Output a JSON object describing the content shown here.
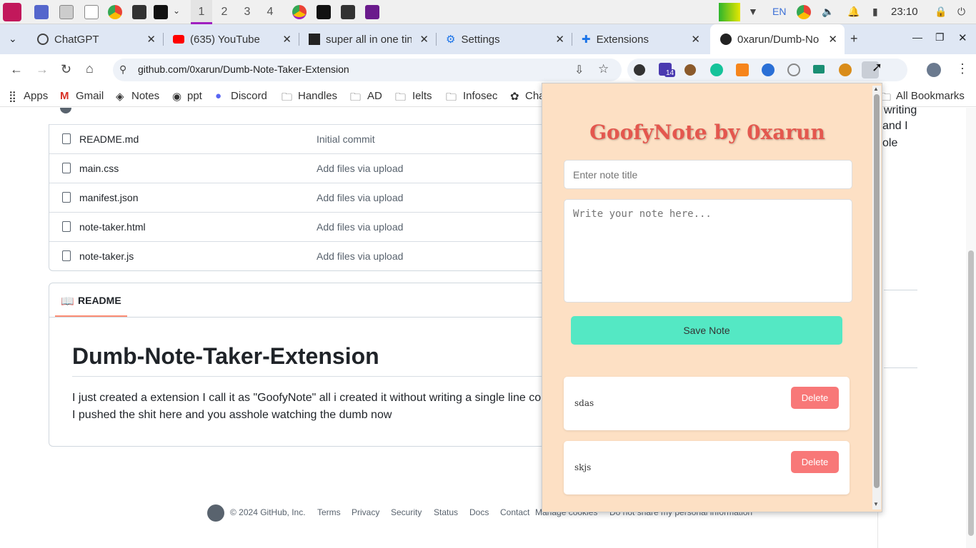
{
  "taskbar": {
    "workspaces": [
      "1",
      "2",
      "3",
      "4"
    ],
    "lang": "EN",
    "time": "23:10"
  },
  "tabs": [
    {
      "title": "ChatGPT"
    },
    {
      "title": "(635) YouTube"
    },
    {
      "title": "super all in one tin"
    },
    {
      "title": "Settings"
    },
    {
      "title": "Extensions"
    },
    {
      "title": "0xarun/Dumb-No"
    }
  ],
  "toolbar": {
    "url": "github.com/0xarun/Dumb-Note-Taker-Extension",
    "ext_badge": "14"
  },
  "bookmarks": [
    "Apps",
    "Gmail",
    "Notes",
    "ppt",
    "Discord",
    "Handles",
    "AD",
    "Ielts",
    "Infosec",
    "Cha",
    "All Bookmarks"
  ],
  "files": [
    {
      "name": "README.md",
      "msg": "Initial commit"
    },
    {
      "name": "main.css",
      "msg": "Add files via upload"
    },
    {
      "name": "manifest.json",
      "msg": "Add files via upload"
    },
    {
      "name": "note-taker.html",
      "msg": "Add files via upload"
    },
    {
      "name": "note-taker.js",
      "msg": "Add files via upload"
    }
  ],
  "readme": {
    "tab_label": "README",
    "title": "Dumb-Note-Taker-Extension",
    "line1": "I just created a extension I call it as \"GoofyNote\" all i created it without writing a single line co",
    "line2": "I pushed the shit here and you asshole watching the dumb now"
  },
  "right_side": {
    "text1": "writing",
    "text2": "and I",
    "text3": "ole"
  },
  "footer": {
    "copyright": "© 2024 GitHub, Inc.",
    "links": [
      "Terms",
      "Privacy",
      "Security",
      "Status",
      "Docs",
      "Contact",
      "Manage cookies",
      "Do not share my personal information"
    ]
  },
  "popup": {
    "title": "GoofyNote by 0xarun",
    "title_placeholder": "Enter note title",
    "body_placeholder": "Write your note here...",
    "save_label": "Save Note",
    "notes": [
      {
        "title": "sdas",
        "delete_label": "Delete"
      },
      {
        "title": "skjs",
        "delete_label": "Delete"
      }
    ]
  }
}
